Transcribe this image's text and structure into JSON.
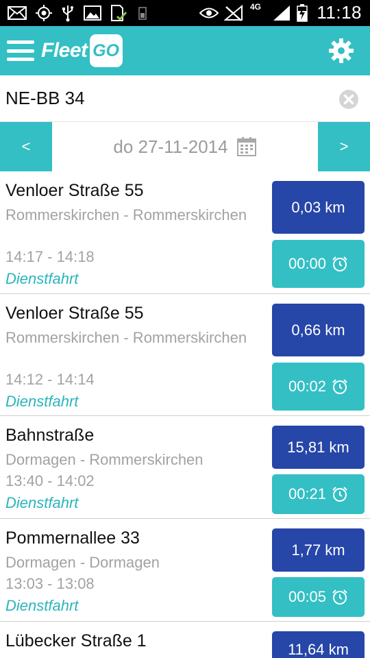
{
  "status_bar": {
    "time": "11:18",
    "network": "4G",
    "icons": [
      "mail-icon",
      "gps-icon",
      "usb-icon",
      "image-icon",
      "sd-card-check-icon",
      "battery-small-icon",
      "eye-icon",
      "no-signal-icon",
      "signal-icon",
      "battery-charging-icon"
    ]
  },
  "app_bar": {
    "logo_text": "Fleet",
    "logo_box_text": "GO",
    "menu_icon": "hamburger-menu-icon",
    "settings_icon": "gear-icon"
  },
  "vehicle": {
    "value": "NE-BB 34",
    "clear_icon": "clear-circle-icon"
  },
  "date_nav": {
    "prev_label": "<",
    "next_label": ">",
    "date": "do 27-11-2014",
    "calendar_icon": "calendar-icon"
  },
  "trips": [
    {
      "street": "Venloer Straße 55",
      "route": "Rommerskirchen - Rommerskirchen",
      "times": "14:17 - 14:18",
      "type": "Dienstfahrt",
      "distance": "0,03 km",
      "duration": "00:00"
    },
    {
      "street": "Venloer Straße 55",
      "route": "Rommerskirchen - Rommerskirchen",
      "times": "14:12 - 14:14",
      "type": "Dienstfahrt",
      "distance": "0,66 km",
      "duration": "00:02"
    },
    {
      "street": "Bahnstraße",
      "route": "Dormagen - Rommerskirchen",
      "times": "13:40 - 14:02",
      "type": "Dienstfahrt",
      "distance": "15,81 km",
      "duration": "00:21"
    },
    {
      "street": "Pommernallee 33",
      "route": "Dormagen - Dormagen",
      "times": "13:03 - 13:08",
      "type": "Dienstfahrt",
      "distance": "1,77 km",
      "duration": "00:05"
    },
    {
      "street": "Lübecker Straße 1",
      "distance": "11,64 km"
    }
  ],
  "colors": {
    "accent": "#33bfc4",
    "distance_button": "#2646a8",
    "trip_type": "#2ab4bd"
  }
}
